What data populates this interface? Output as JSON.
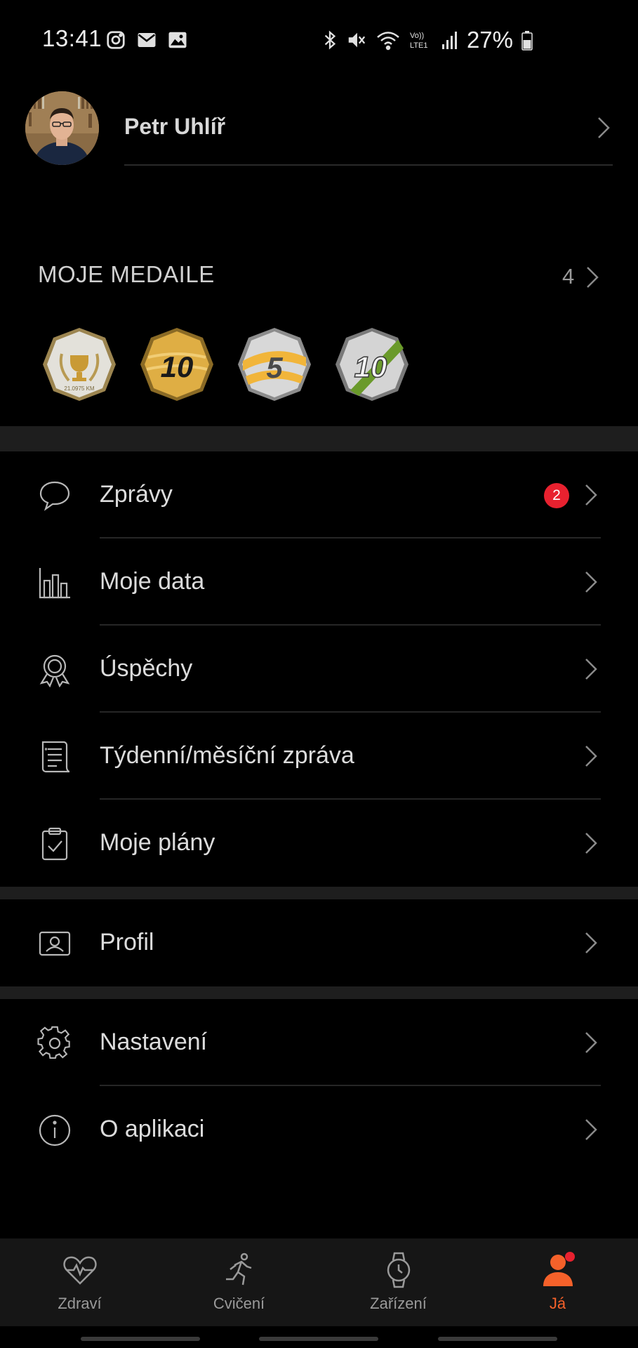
{
  "status_bar": {
    "time": "13:41",
    "battery": "27%",
    "left_icons": [
      "instagram-icon",
      "mail-icon",
      "gallery-icon"
    ],
    "right_icons": [
      "bluetooth-icon",
      "mute-icon",
      "wifi-icon",
      "volte-icon",
      "signal-icon",
      "battery-icon"
    ]
  },
  "profile": {
    "name": "Petr Uhlíř"
  },
  "medals": {
    "title": "MOJE MEDAILE",
    "count": "4",
    "items": [
      {
        "icon": "trophy-medal-icon",
        "label": "21.0975 KM",
        "color": "#c9c9c9"
      },
      {
        "icon": "gold-10km-medal-icon",
        "label": "10",
        "color": "#d8a93a"
      },
      {
        "icon": "5km-medal-icon",
        "label": "5",
        "color": "#f0b23a"
      },
      {
        "icon": "silver-10km-medal-icon",
        "label": "10",
        "color": "#cfcfcf"
      }
    ]
  },
  "menu": [
    {
      "label": "Zprávy",
      "icon": "chat-bubble-icon",
      "badge": "2"
    },
    {
      "label": "Moje data",
      "icon": "bar-chart-icon"
    },
    {
      "label": "Úspěchy",
      "icon": "award-icon"
    },
    {
      "label": "Týdenní/měsíční zpráva",
      "icon": "report-icon"
    },
    {
      "label": "Moje plány",
      "icon": "clipboard-check-icon"
    },
    {
      "label": "Profil",
      "icon": "profile-card-icon"
    },
    {
      "label": "Nastavení",
      "icon": "gear-icon"
    },
    {
      "label": "O aplikaci",
      "icon": "info-icon"
    }
  ],
  "bottom_nav": [
    {
      "label": "Zdraví",
      "icon": "heart-pulse-icon"
    },
    {
      "label": "Cvičení",
      "icon": "running-icon"
    },
    {
      "label": "Zařízení",
      "icon": "watch-icon"
    },
    {
      "label": "Já",
      "icon": "person-icon",
      "active": true
    }
  ],
  "colors": {
    "accent": "#f5612a",
    "badge": "#e8212f",
    "background": "#000000"
  }
}
